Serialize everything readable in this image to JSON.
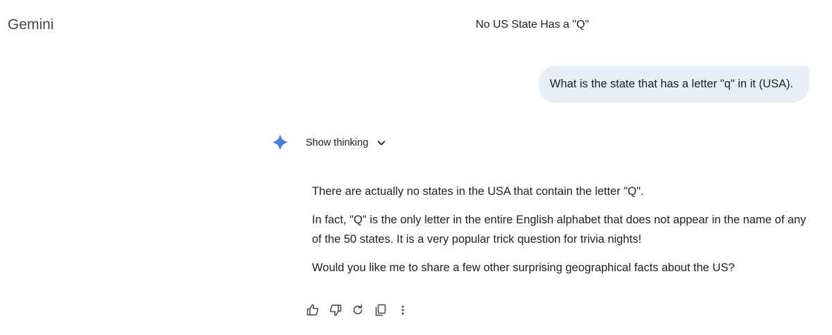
{
  "header": {
    "app_name": "Gemini",
    "conversation_title": "No US State Has a \"Q\""
  },
  "user_message": {
    "text": "What is the state that has a letter \"q\" in it (USA)."
  },
  "model_response": {
    "show_thinking_label": "Show thinking",
    "paragraphs": [
      "There are actually no states in the USA that contain the letter \"Q\".",
      "In fact, \"Q\" is the only letter in the entire English alphabet that does not appear in the name of any of the 50 states. It is a very popular trick question for trivia nights!",
      "Would you like me to share a few other surprising geographical facts about the US?"
    ]
  },
  "actions": [
    {
      "icon": "thumb-up-icon"
    },
    {
      "icon": "thumb-down-icon"
    },
    {
      "icon": "regenerate-icon"
    },
    {
      "icon": "copy-icon"
    },
    {
      "icon": "more-vert-icon"
    }
  ],
  "colors": {
    "user_bubble": "#e9eef6",
    "gemini_spark": "#4285f4",
    "text": "#1f1f1f",
    "icon": "#444746"
  }
}
